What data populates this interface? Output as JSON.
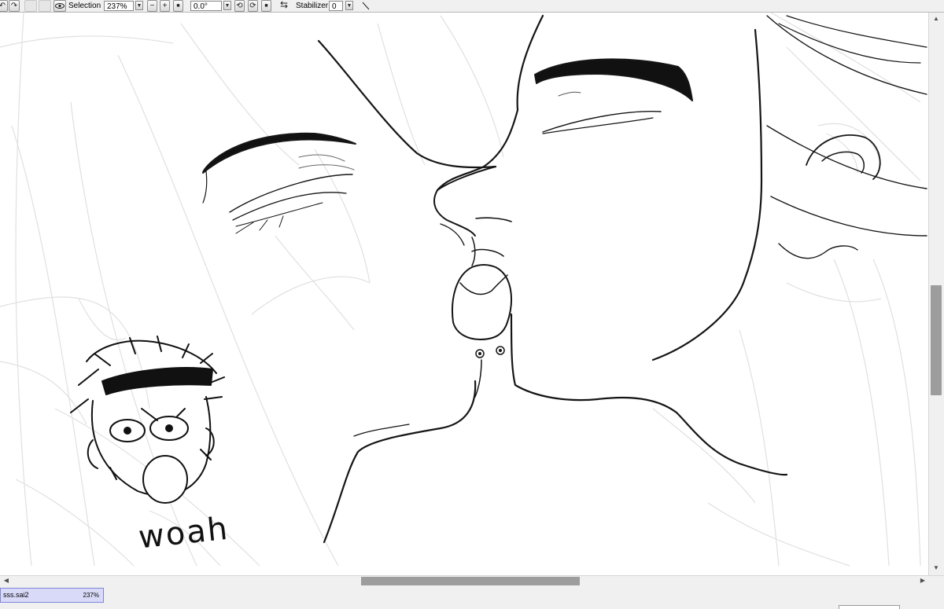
{
  "toolbar": {
    "selection_label": "Selection",
    "zoom_value": "237%",
    "rotation_value": "0.0°",
    "stabilizer_label": "Stabilizer",
    "stabilizer_value": "0"
  },
  "artwork": {
    "caption": "woah"
  },
  "file_tabs": [
    {
      "name": "sss.sai2",
      "zoom": "237%"
    }
  ],
  "colors": {
    "toolbar_bg": "#f0f0f0",
    "scrollbar_thumb": "#9d9d9d",
    "active_tab_bg": "#d8daf8",
    "active_tab_border": "#7f86d8",
    "canvas_bg": "#ffffff"
  },
  "icons": [
    "undo-icon",
    "redo-icon",
    "view-eye-icon",
    "zoom-out-icon",
    "zoom-in-icon",
    "zoom-reset-icon",
    "rotate-left-icon",
    "rotate-right-icon",
    "rotate-reset-icon",
    "flip-horizontal-icon",
    "pen-line-icon",
    "dropdown-arrow-icon"
  ]
}
